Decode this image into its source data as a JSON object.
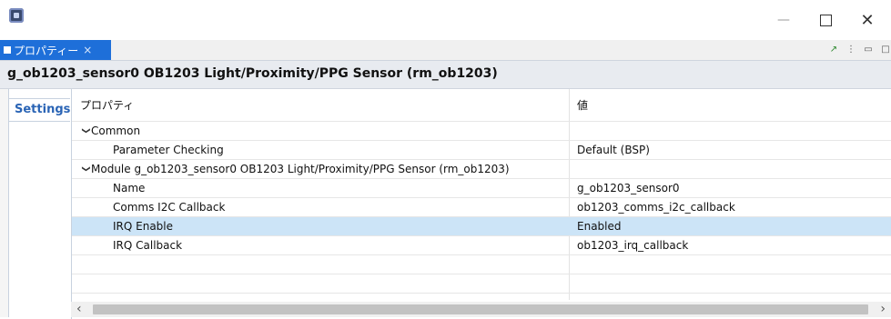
{
  "window": {
    "title": ""
  },
  "tabs": [
    {
      "label": "プロパティー",
      "close": "×"
    }
  ],
  "header": {
    "title": "g_ob1203_sensor0 OB1203 Light/Proximity/PPG Sensor (rm_ob1203)"
  },
  "side_tabs": [
    {
      "label": "Settings"
    }
  ],
  "table": {
    "columns": [
      "プロパティ",
      "値"
    ],
    "rows": [
      {
        "property": "Common",
        "value": "",
        "level": 0,
        "expandable": true
      },
      {
        "property": "Parameter Checking",
        "value": "Default (BSP)",
        "level": 1
      },
      {
        "property": "Module g_ob1203_sensor0 OB1203 Light/Proximity/PPG Sensor (rm_ob1203)",
        "value": "",
        "level": 0,
        "expandable": true
      },
      {
        "property": "Name",
        "value": "g_ob1203_sensor0",
        "level": 1
      },
      {
        "property": "Comms I2C Callback",
        "value": "ob1203_comms_i2c_callback",
        "level": 1
      },
      {
        "property": "IRQ Enable",
        "value": "Enabled",
        "level": 1,
        "selected": true
      },
      {
        "property": "IRQ Callback",
        "value": "ob1203_irq_callback",
        "level": 1
      }
    ]
  },
  "icons": {
    "app": "app-icon",
    "minimize": "minimize-icon",
    "maximize": "maximize-icon",
    "close": "close-icon",
    "chevron": "chevron-down-icon"
  },
  "colors": {
    "accent": "#1e6fd9",
    "selection": "#cce4f7",
    "header_bg": "#e8ebf0"
  }
}
